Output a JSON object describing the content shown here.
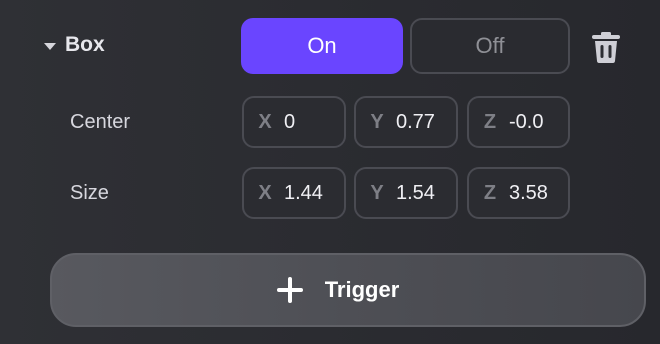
{
  "box": {
    "label": "Box",
    "toggle": {
      "on_label": "On",
      "off_label": "Off",
      "selected": "On"
    }
  },
  "rows": {
    "center": {
      "label": "Center",
      "x_axis": "X",
      "x": "0",
      "y_axis": "Y",
      "y": "0.77",
      "z_axis": "Z",
      "z": "-0.0"
    },
    "size": {
      "label": "Size",
      "x_axis": "X",
      "x": "1.44",
      "y_axis": "Y",
      "y": "1.54",
      "z_axis": "Z",
      "z": "3.58"
    }
  },
  "actions": {
    "trigger_label": "Trigger"
  },
  "colors": {
    "accent": "#6a45ff",
    "background": "#2f3035",
    "field_border": "#4a4b52"
  },
  "icons": {
    "collapse": "caret-down-icon",
    "delete": "trash-icon",
    "add": "plus-icon"
  }
}
